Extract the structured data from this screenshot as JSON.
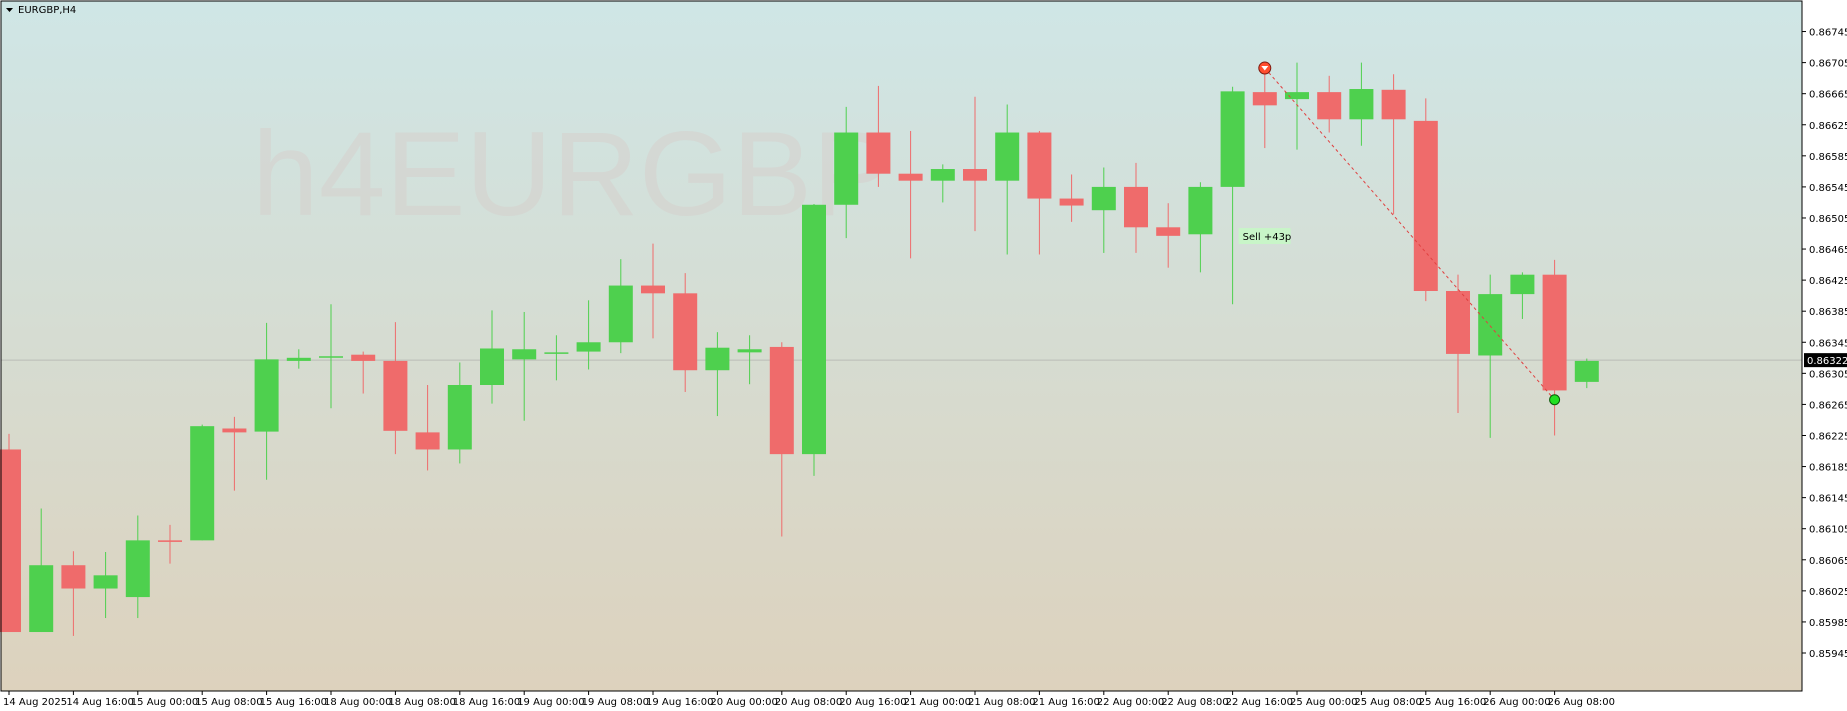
{
  "window": {
    "title": "EURGBP,H4",
    "watermark": "h4EURGBP"
  },
  "colors": {
    "bg_top": "#cfe6e6",
    "bg_bottom": "#ddd2bd",
    "bull": "#4ed04e",
    "bear": "#ef6b6b",
    "grid_line": "#9e9e9e",
    "axis": "#000000",
    "label_bg": "#c8f5c8"
  },
  "trade": {
    "label": "Sell +43p",
    "entry_price": 0.86698,
    "exit_price": 0.86271
  },
  "current_price": {
    "value": 0.86322,
    "label": "0.86322"
  },
  "chart_data": {
    "type": "candlestick",
    "symbol": "EURGBP",
    "timeframe": "H4",
    "ylim": [
      0.85945,
      0.86765
    ],
    "y_ticks": [
      "0.86745",
      "0.86705",
      "0.86665",
      "0.86625",
      "0.86585",
      "0.86545",
      "0.86505",
      "0.86465",
      "0.86425",
      "0.86385",
      "0.86345",
      "0.86305",
      "0.86265",
      "0.86225",
      "0.86185",
      "0.86145",
      "0.86105",
      "0.86065",
      "0.86025",
      "0.85985",
      "0.85945"
    ],
    "x_labels": [
      "14 Aug 2025",
      "14 Aug 16:00",
      "15 Aug 00:00",
      "15 Aug 08:00",
      "15 Aug 16:00",
      "18 Aug 00:00",
      "18 Aug 08:00",
      "18 Aug 16:00",
      "19 Aug 00:00",
      "19 Aug 08:00",
      "19 Aug 16:00",
      "20 Aug 00:00",
      "20 Aug 08:00",
      "20 Aug 16:00",
      "21 Aug 00:00",
      "21 Aug 08:00",
      "21 Aug 16:00",
      "22 Aug 00:00",
      "22 Aug 08:00",
      "22 Aug 16:00",
      "25 Aug 00:00",
      "25 Aug 08:00",
      "25 Aug 16:00",
      "26 Aug 00:00",
      "26 Aug 08:00"
    ],
    "candles": [
      {
        "o": 0.86207,
        "h": 0.86227,
        "l": 0.85972,
        "c": 0.85972
      },
      {
        "o": 0.85972,
        "h": 0.86131,
        "l": 0.85972,
        "c": 0.86058
      },
      {
        "o": 0.86058,
        "h": 0.86076,
        "l": 0.85967,
        "c": 0.86028
      },
      {
        "o": 0.86028,
        "h": 0.86075,
        "l": 0.8599,
        "c": 0.86045
      },
      {
        "o": 0.86017,
        "h": 0.86122,
        "l": 0.8599,
        "c": 0.8609
      },
      {
        "o": 0.8609,
        "h": 0.8611,
        "l": 0.8606,
        "c": 0.86088
      },
      {
        "o": 0.8609,
        "h": 0.86239,
        "l": 0.8609,
        "c": 0.86237
      },
      {
        "o": 0.86234,
        "h": 0.86249,
        "l": 0.86154,
        "c": 0.86229
      },
      {
        "o": 0.8623,
        "h": 0.8637,
        "l": 0.86168,
        "c": 0.86323
      },
      {
        "o": 0.86321,
        "h": 0.86336,
        "l": 0.86311,
        "c": 0.86325
      },
      {
        "o": 0.86326,
        "h": 0.86394,
        "l": 0.8626,
        "c": 0.86327
      },
      {
        "o": 0.86329,
        "h": 0.86333,
        "l": 0.86279,
        "c": 0.86321
      },
      {
        "o": 0.86321,
        "h": 0.86371,
        "l": 0.86201,
        "c": 0.86231
      },
      {
        "o": 0.86229,
        "h": 0.8629,
        "l": 0.8618,
        "c": 0.86207
      },
      {
        "o": 0.86207,
        "h": 0.86319,
        "l": 0.86189,
        "c": 0.8629
      },
      {
        "o": 0.8629,
        "h": 0.86386,
        "l": 0.86266,
        "c": 0.86337
      },
      {
        "o": 0.86323,
        "h": 0.86384,
        "l": 0.86244,
        "c": 0.86336
      },
      {
        "o": 0.86332,
        "h": 0.86354,
        "l": 0.86296,
        "c": 0.86332
      },
      {
        "o": 0.86333,
        "h": 0.86399,
        "l": 0.8631,
        "c": 0.86345
      },
      {
        "o": 0.86345,
        "h": 0.86452,
        "l": 0.86331,
        "c": 0.86418
      },
      {
        "o": 0.86418,
        "h": 0.86472,
        "l": 0.8635,
        "c": 0.86408
      },
      {
        "o": 0.86408,
        "h": 0.86434,
        "l": 0.86281,
        "c": 0.86309
      },
      {
        "o": 0.86309,
        "h": 0.86358,
        "l": 0.8625,
        "c": 0.86338
      },
      {
        "o": 0.86332,
        "h": 0.86354,
        "l": 0.86291,
        "c": 0.86336
      },
      {
        "o": 0.86339,
        "h": 0.86345,
        "l": 0.86095,
        "c": 0.86201
      },
      {
        "o": 0.86201,
        "h": 0.86523,
        "l": 0.86173,
        "c": 0.86522
      },
      {
        "o": 0.86522,
        "h": 0.86648,
        "l": 0.86479,
        "c": 0.86615
      },
      {
        "o": 0.86615,
        "h": 0.86675,
        "l": 0.86545,
        "c": 0.86562
      },
      {
        "o": 0.86562,
        "h": 0.86617,
        "l": 0.86453,
        "c": 0.86553
      },
      {
        "o": 0.86553,
        "h": 0.86574,
        "l": 0.86525,
        "c": 0.86568
      },
      {
        "o": 0.86568,
        "h": 0.86661,
        "l": 0.86488,
        "c": 0.86553
      },
      {
        "o": 0.86553,
        "h": 0.86651,
        "l": 0.86458,
        "c": 0.86615
      },
      {
        "o": 0.86615,
        "h": 0.86617,
        "l": 0.86458,
        "c": 0.8653
      },
      {
        "o": 0.8653,
        "h": 0.86561,
        "l": 0.865,
        "c": 0.86521
      },
      {
        "o": 0.86515,
        "h": 0.8657,
        "l": 0.8646,
        "c": 0.86545
      },
      {
        "o": 0.86545,
        "h": 0.86576,
        "l": 0.8646,
        "c": 0.86493
      },
      {
        "o": 0.86493,
        "h": 0.86524,
        "l": 0.86441,
        "c": 0.86482
      },
      {
        "o": 0.86484,
        "h": 0.86551,
        "l": 0.86435,
        "c": 0.86545
      },
      {
        "o": 0.86545,
        "h": 0.86674,
        "l": 0.86394,
        "c": 0.86668
      },
      {
        "o": 0.86667,
        "h": 0.86704,
        "l": 0.86595,
        "c": 0.8665
      },
      {
        "o": 0.86658,
        "h": 0.86705,
        "l": 0.86593,
        "c": 0.86667
      },
      {
        "o": 0.86667,
        "h": 0.86688,
        "l": 0.86615,
        "c": 0.86632
      },
      {
        "o": 0.86632,
        "h": 0.86705,
        "l": 0.86598,
        "c": 0.86671
      },
      {
        "o": 0.8667,
        "h": 0.8669,
        "l": 0.8651,
        "c": 0.86632
      },
      {
        "o": 0.8663,
        "h": 0.86659,
        "l": 0.86398,
        "c": 0.86411
      },
      {
        "o": 0.86411,
        "h": 0.86432,
        "l": 0.86254,
        "c": 0.8633
      },
      {
        "o": 0.86328,
        "h": 0.86432,
        "l": 0.86222,
        "c": 0.86407
      },
      {
        "o": 0.86407,
        "h": 0.86435,
        "l": 0.86375,
        "c": 0.86432
      },
      {
        "o": 0.86432,
        "h": 0.86451,
        "l": 0.86225,
        "c": 0.86283
      },
      {
        "o": 0.86294,
        "h": 0.86324,
        "l": 0.86286,
        "c": 0.86321
      }
    ]
  }
}
